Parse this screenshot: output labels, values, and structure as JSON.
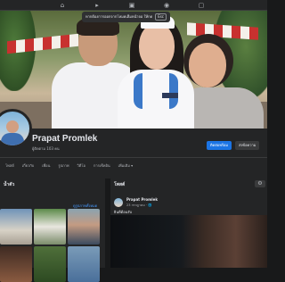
{
  "topbar": {
    "icons": [
      "home-icon",
      "video-icon",
      "marketplace-icon",
      "groups-icon",
      "gaming-icon"
    ]
  },
  "tooltip": {
    "text": "หากต้องการออกจากโหมดเต็มหน้าจอ ให้กด",
    "key": "Esc"
  },
  "profile": {
    "name": "Prapat Promlek",
    "followers": "ผู้ติดตาม 103 คน",
    "primary_button": "ติดต่อพร้อม",
    "secondary_button": "ส่งข้อความ"
  },
  "tabs": [
    "โพสต์",
    "เกี่ยวกับ",
    "เพื่อน",
    "รูปภาพ",
    "วิดีโอ",
    "การเช็คอิน",
    "เพิ่มเติม ▾"
  ],
  "left_card": {
    "title": "น้ำตัว",
    "link": "ดูรูปภาพทั้งหมด"
  },
  "right_card": {
    "title": "โพสต์",
    "post_author": "Prapat Promlek",
    "post_date": "23 กรกฎาคม · 🌐",
    "post_text": "ยินดีต้อนรับ"
  },
  "colors": {
    "background": "#18191a",
    "surface": "#242526",
    "accent": "#1b74e4",
    "link": "#4599ff"
  }
}
